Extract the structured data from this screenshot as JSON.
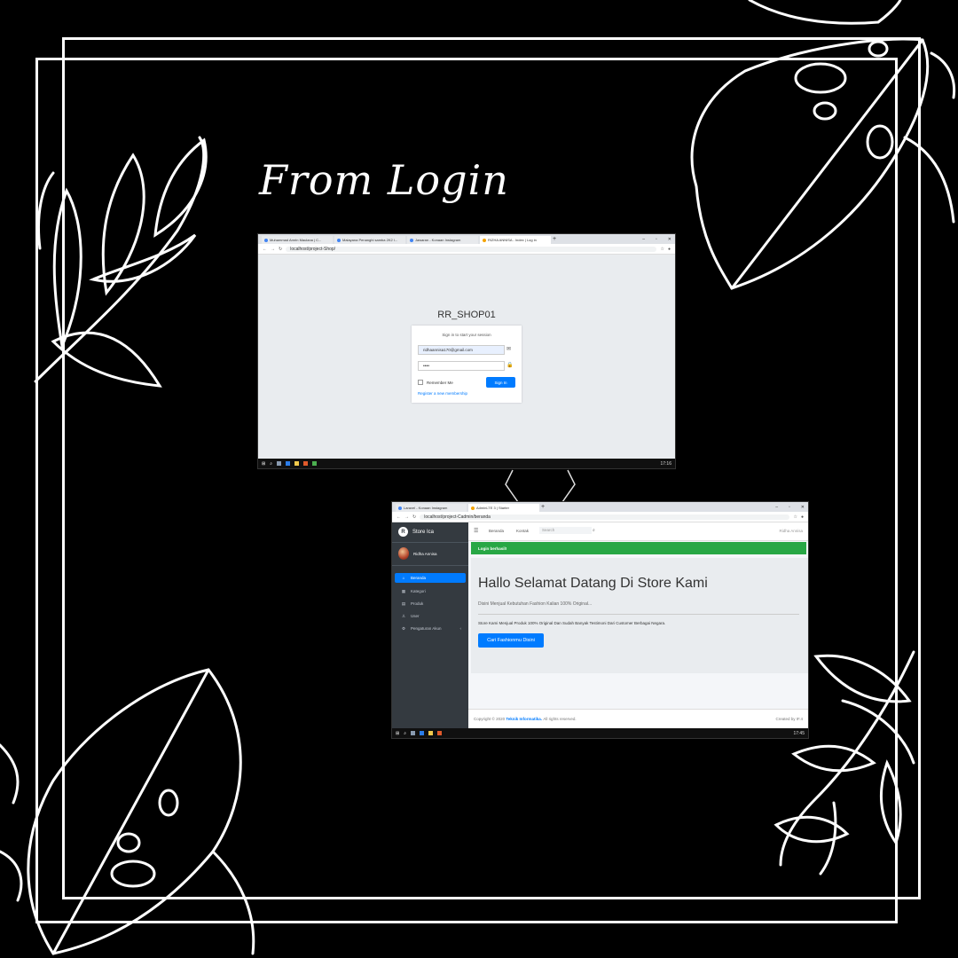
{
  "title": "From Login",
  "login_window": {
    "tabs": [
      {
        "label": "Muhammad Amrin Maulana | C...",
        "active": false
      },
      {
        "label": "Malayana Penanghi samba 2K2 l...",
        "active": false
      },
      {
        "label": "Jawaran - Konaan Instagram",
        "active": false
      },
      {
        "label": "RIZHA ANNISA - Index | Log in",
        "active": true
      }
    ],
    "url": "localhost/project-Shop/",
    "brand": "RR_SHOP01",
    "card_title": "Sign in to start your session",
    "email_value": "ridhaannisa170@gmail.com",
    "password_value": "••••",
    "remember_label": "Remember Me",
    "signin_label": "Sign In",
    "register_link": "Register a new membership",
    "clock": "17:16"
  },
  "dashboard_window": {
    "tabs": [
      {
        "label": "Laravel - Konaan Instagram",
        "active": false
      },
      {
        "label": "AdminLTE 3 | Starter",
        "active": true
      }
    ],
    "url": "localhost/project-Cadmin/beranda",
    "sidebar": {
      "brand": "Store Ica",
      "user": "Ridha Annisa",
      "items": [
        {
          "label": "Beranda",
          "icon": "home-icon",
          "glyph": "⌂",
          "active": true
        },
        {
          "label": "Kategori",
          "icon": "grid-icon",
          "glyph": "▦",
          "active": false
        },
        {
          "label": "Produk",
          "icon": "box-icon",
          "glyph": "▤",
          "active": false
        },
        {
          "label": "User",
          "icon": "user-icon",
          "glyph": "♙",
          "active": false
        },
        {
          "label": "Pengaturan Akun",
          "icon": "gear-icon",
          "glyph": "⚙",
          "active": false
        }
      ]
    },
    "topnav": {
      "menu_icon": "☰",
      "links": [
        "Beranda",
        "Kontak"
      ],
      "search_placeholder": "Search",
      "user": "Ridha Annisa"
    },
    "alert": "Login berhasil!",
    "heading": "Hallo Selamat Datang Di Store Kami",
    "lead": "Disini Menjual Kebutuhan Fashion Kalian 100% Original...",
    "body_text": "Store Kami Menjual Produk 100% Original Dan Sudah Banyak Testimoni Dari Customer Berbagai Negara.",
    "cta": "Cari Fashionmu Disini",
    "footer_left_prefix": "Copyright © 2020",
    "footer_brand": "Teknik Informatika.",
    "footer_rights": "All rights reserved.",
    "footer_right": "Created by IF.4",
    "clock": "17:45"
  }
}
